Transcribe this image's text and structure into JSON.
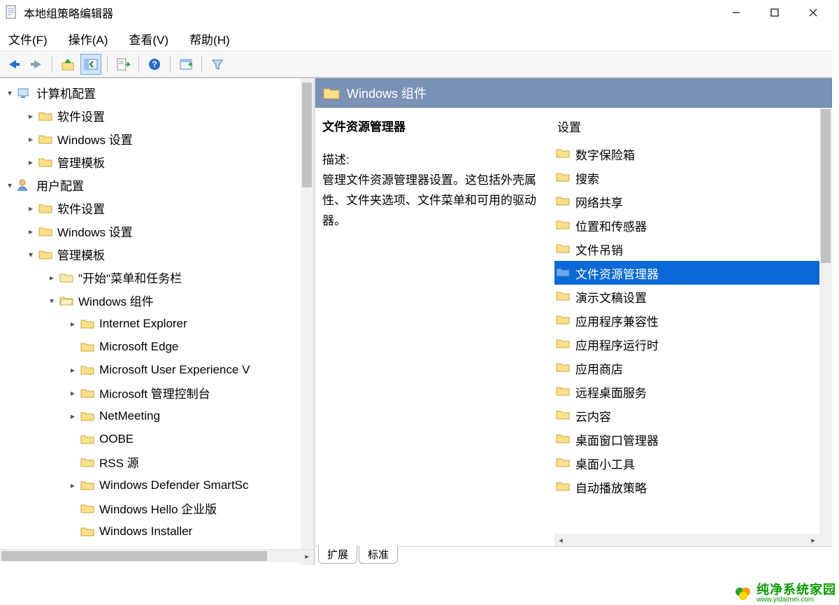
{
  "window": {
    "title": "本地组策略编辑器"
  },
  "menus": {
    "file": "文件(F)",
    "action": "操作(A)",
    "view": "查看(V)",
    "help": "帮助(H)"
  },
  "tree": {
    "root1": "计算机配置",
    "root1_children": {
      "c0": "软件设置",
      "c1": "Windows 设置",
      "c2": "管理模板"
    },
    "root2": "用户配置",
    "root2_children": {
      "c0": "软件设置",
      "c1": "Windows 设置",
      "c2": "管理模板"
    },
    "admin_children": {
      "c0": "\"开始\"菜单和任务栏",
      "c1": "Windows 组件"
    },
    "wincomp_children": {
      "c0": "Internet Explorer",
      "c1": "Microsoft Edge",
      "c2": "Microsoft User Experience V",
      "c3": "Microsoft 管理控制台",
      "c4": "NetMeeting",
      "c5": "OOBE",
      "c6": "RSS 源",
      "c7": "Windows Defender SmartSc",
      "c8": "Windows Hello 企业版",
      "c9": "Windows Installer"
    }
  },
  "detail": {
    "header": "Windows 组件",
    "policy_title": "文件资源管理器",
    "desc_label": "描述:",
    "desc_text": "管理文件资源管理器设置。这包括外壳属性、文件夹选项、文件菜单和可用的驱动器。",
    "settings_header": "设置",
    "settings": {
      "s0": "数字保险箱",
      "s1": "搜索",
      "s2": "网络共享",
      "s3": "位置和传感器",
      "s4": "文件吊销",
      "s5": "文件资源管理器",
      "s6": "演示文稿设置",
      "s7": "应用程序兼容性",
      "s8": "应用程序运行时",
      "s9": "应用商店",
      "s10": "远程桌面服务",
      "s11": "云内容",
      "s12": "桌面窗口管理器",
      "s13": "桌面小工具",
      "s14": "自动播放策略"
    },
    "selected_index": 5
  },
  "tabs": {
    "extended": "扩展",
    "standard": "标准"
  },
  "watermark": {
    "main": "纯净系统家园",
    "sub": "www.yidaimei.com"
  }
}
